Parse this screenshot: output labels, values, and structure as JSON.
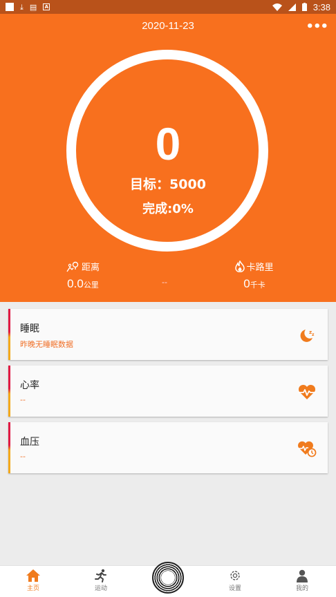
{
  "status_bar": {
    "time": "3:38",
    "notif_icon_a": "A"
  },
  "header": {
    "date": "2020-11-23",
    "steps": "0",
    "goal_text": "目标：5000",
    "complete_text": "完成:0%",
    "distance": {
      "label": "距离",
      "value": "0.0",
      "unit": "公里"
    },
    "middle": "--",
    "calories": {
      "label": "卡路里",
      "value": "0",
      "unit": "千卡"
    }
  },
  "cards": [
    {
      "title": "睡眠",
      "subtitle": "昨晚无睡眠数据",
      "icon": "moon-sleep-icon"
    },
    {
      "title": "心率",
      "subtitle": "--",
      "icon": "heart-rate-icon"
    },
    {
      "title": "血压",
      "subtitle": "--",
      "icon": "blood-pressure-icon"
    }
  ],
  "nav": {
    "home": "主页",
    "sport": "运动",
    "settings": "设置",
    "mine": "我的"
  },
  "colors": {
    "accent": "#f8701e",
    "status_bar": "#b9521a",
    "card_bar_top": "#e01943",
    "card_bar_bottom": "#f3a81a",
    "nav_active": "#f07b1d"
  }
}
